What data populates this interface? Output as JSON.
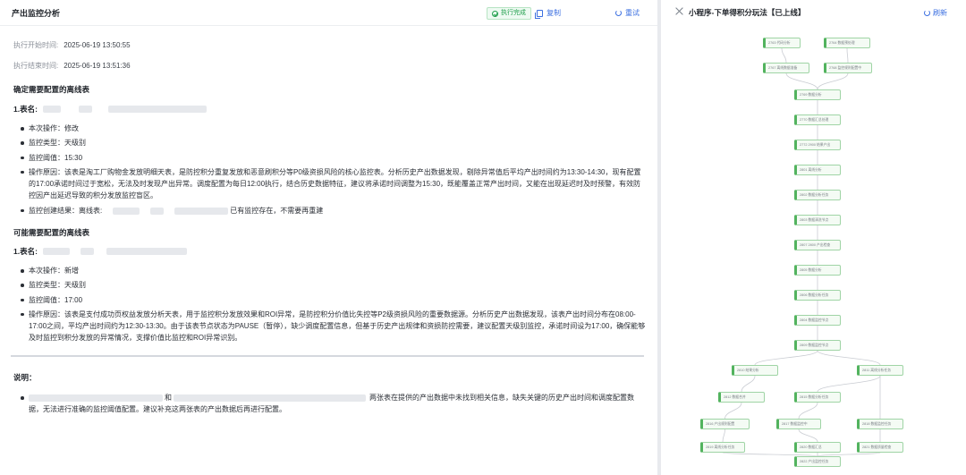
{
  "left": {
    "title": "产出监控分析",
    "status": "执行完成",
    "copy_label": "复制",
    "retry_label": "重试",
    "start_label": "执行开始时间:",
    "start_value": "2025-06-19 13:50:55",
    "end_label": "执行结束时间:",
    "end_value": "2025-06-19 13:51:36",
    "section1": {
      "heading": "确定需要配置的离线表",
      "table_label": "1.表名:",
      "items": [
        "本次操作：修改",
        "监控类型：天级别",
        "监控阈值：15:30",
        "操作原因：该表是淘工厂购物金发放明细天表，是防控积分重复发放和恶意刷积分等P0级资损风险的核心监控表。分析历史产出数据发现，剔除异常值后平均产出时间约为13:30-14:30，现有配置的17:00承诺时间过于宽松，无法及时发现产出异常。调度配置为每日12:00执行，结合历史数据特征，建议将承诺时间调整为15:30，既能覆盖正常产出时间，又能在出现延迟时及时预警，有效防控因产出延迟导致的积分发放监控盲区。"
      ],
      "result_prefix": "监控创建结果：离线表:",
      "result_suffix": "已有监控存在，不需要再重建"
    },
    "section2": {
      "heading": "可能需要配置的离线表",
      "table_label": "1.表名:",
      "items": [
        "本次操作：新增",
        "监控类型：天级别",
        "监控阈值：17:00",
        "操作原因：该表是支付成功页权益发放分析天表，用于监控积分发放效果和ROI异常，是防控积分价值比失控等P2级资损风险的重要数据源。分析历史产出数据发现，该表产出时间分布在08:00-17:00之间，平均产出时间约为12:30-13:30。由于该表节点状态为PAUSE（暂停），缺少调度配置信息，但基于历史产出规律和资损防控需要，建议配置天级别监控，承诺时间设为17:00，确保能够及时监控到积分发放的异常情况，支撑价值比监控和ROI异常识别。"
      ]
    },
    "note": {
      "title": "说明：",
      "connector": "和",
      "text": "两张表在提供的产出数据中未找到相关信息，缺失关键的历史产出时间和调度配置数据，无法进行准确的监控阈值配置。建议补充这两张表的产出数据后再进行配置。"
    }
  },
  "right": {
    "title": "小程序-下单得积分玩法【已上线】",
    "refresh_label": "刷新"
  },
  "dag": {
    "nodes": [
      {
        "id": "n1",
        "label": "2763 代码分析"
      },
      {
        "id": "n2",
        "label": "2764 数据预处理"
      },
      {
        "id": "n3",
        "label": "2767 离线数据准备"
      },
      {
        "id": "n4",
        "label": "2768 监控规则配置中"
      },
      {
        "id": "n5",
        "label": "2769 数据分析"
      },
      {
        "id": "n6",
        "label": "2770 数据汇总处理"
      },
      {
        "id": "n7",
        "label": "2772 2900 结果产出"
      },
      {
        "id": "n8",
        "label": "2801 离线分析"
      },
      {
        "id": "n9",
        "label": "2802 数据分析任务"
      },
      {
        "id": "n10",
        "label": "2803 数据清洗节点"
      },
      {
        "id": "n11",
        "label": "2807 2800 产出检查"
      },
      {
        "id": "n12",
        "label": "2805 数据分析"
      },
      {
        "id": "n13",
        "label": "2806 数据分析任务"
      },
      {
        "id": "n14",
        "label": "2804 数据监控节点"
      },
      {
        "id": "n15",
        "label": "2809 数据监控节点"
      },
      {
        "id": "n16",
        "label": "2810 结果分析"
      },
      {
        "id": "n17",
        "label": "2811 离线分析任务"
      },
      {
        "id": "n18",
        "label": "2812 数据合并"
      },
      {
        "id": "n19",
        "label": "2815 数据分析任务"
      },
      {
        "id": "n20",
        "label": "2816 产出规则配置"
      },
      {
        "id": "n21",
        "label": "2817 数据监控中"
      },
      {
        "id": "n22",
        "label": "2818 数据监控任务"
      },
      {
        "id": "n23",
        "label": "2819 离线分析任务"
      },
      {
        "id": "n24",
        "label": "2820 数据汇总"
      },
      {
        "id": "n25",
        "label": "2821 数据质量检查"
      },
      {
        "id": "n26",
        "label": "2822 产出监控任务"
      },
      {
        "id": "n27",
        "label": "2823 数据合并"
      },
      {
        "id": "n28",
        "label": "2824 结果产出"
      }
    ]
  }
}
